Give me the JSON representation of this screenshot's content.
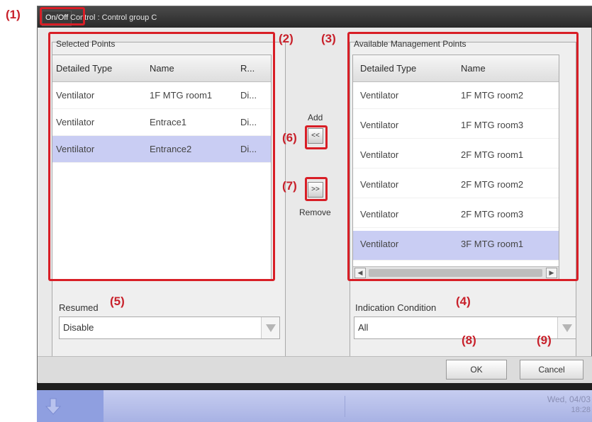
{
  "dialog": {
    "title_tab": "On/Off",
    "title_rest": "Control : Control group C"
  },
  "selected_points": {
    "label": "Selected Points",
    "columns": [
      "Detailed Type",
      "Name",
      "R..."
    ],
    "rows": [
      {
        "type": "Ventilator",
        "name": "1F MTG room1",
        "r": "Di...",
        "selected": false
      },
      {
        "type": "Ventilator",
        "name": "Entrace1",
        "r": "Di...",
        "selected": false
      },
      {
        "type": "Ventilator",
        "name": "Entrance2",
        "r": "Di...",
        "selected": true
      }
    ]
  },
  "available_points": {
    "label": "Available Management Points",
    "columns": [
      "Detailed Type",
      "Name"
    ],
    "rows": [
      {
        "type": "Ventilator",
        "name": "1F MTG room2",
        "selected": false
      },
      {
        "type": "Ventilator",
        "name": "1F MTG room3",
        "selected": false
      },
      {
        "type": "Ventilator",
        "name": "2F MTG room1",
        "selected": false
      },
      {
        "type": "Ventilator",
        "name": "2F MTG room2",
        "selected": false
      },
      {
        "type": "Ventilator",
        "name": "2F MTG room3",
        "selected": false
      },
      {
        "type": "Ventilator",
        "name": "3F MTG room1",
        "selected": true
      }
    ]
  },
  "move": {
    "add_label": "Add",
    "add_button": "<<",
    "remove_button": ">>",
    "remove_label": "Remove"
  },
  "resumed": {
    "label": "Resumed",
    "value": "Disable"
  },
  "indication": {
    "label": "Indication Condition",
    "value": "All"
  },
  "footer": {
    "ok": "OK",
    "cancel": "Cancel"
  },
  "taskbar": {
    "date": "Wed, 04/03",
    "time": "18:28"
  },
  "callouts": {
    "c1": "(1)",
    "c2": "(2)",
    "c3": "(3)",
    "c4": "(4)",
    "c5": "(5)",
    "c6": "(6)",
    "c7": "(7)",
    "c8": "(8)",
    "c9": "(9)"
  },
  "colors": {
    "callout_red": "#c8202a",
    "selection": "#c9cdf3",
    "title_bar": "#2a2a2a",
    "taskbar": "#a8b2e4"
  },
  "icons": {
    "dropdown": "triangle-down-icon",
    "scroll_left": "triangle-left-icon",
    "scroll_right": "triangle-right-icon",
    "home": "arrow-down-icon"
  }
}
